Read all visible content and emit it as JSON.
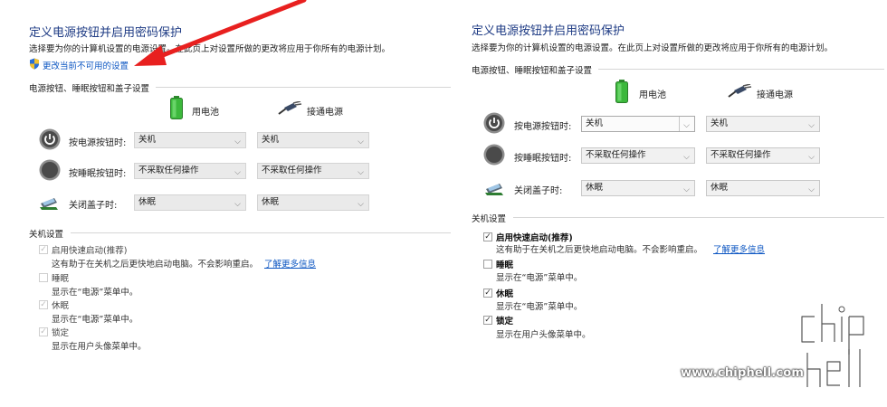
{
  "left": {
    "title": "定义电源按钮并启用密码保护",
    "description": "选择要为你的计算机设置的电源设置。在此页上对设置所做的更改将应用于你所有的电源计划。",
    "change_link": "更改当前不可用的设置",
    "buttons_section": "电源按钮、睡眠按钮和盖子设置",
    "col_battery": "用电池",
    "col_plugged": "接通电源",
    "rows": [
      {
        "label": "按电源按钮时:",
        "battery": "关机",
        "plugged": "关机"
      },
      {
        "label": "按睡眠按钮时:",
        "battery": "不采取任何操作",
        "plugged": "不采取任何操作"
      },
      {
        "label": "关闭盖子时:",
        "battery": "休眠",
        "plugged": "休眠"
      }
    ],
    "shutdown_section": "关机设置",
    "shutdown_items": [
      {
        "label": "启用快速启动(推荐)",
        "checked": true,
        "desc": "这有助于在关机之后更快地启动电脑。不会影响重启。",
        "link": "了解更多信息"
      },
      {
        "label": "睡眠",
        "checked": false,
        "desc": "显示在“电源”菜单中。"
      },
      {
        "label": "休眠",
        "checked": true,
        "desc": "显示在“电源”菜单中。"
      },
      {
        "label": "锁定",
        "checked": true,
        "desc": "显示在用户头像菜单中。"
      }
    ]
  },
  "right": {
    "title": "定义电源按钮并启用密码保护",
    "description": "选择要为你的计算机设置的电源设置。在此页上对设置所做的更改将应用于你所有的电源计划。",
    "buttons_section": "电源按钮、睡眠按钮和盖子设置",
    "col_battery": "用电池",
    "col_plugged": "接通电源",
    "rows": [
      {
        "label": "按电源按钮时:",
        "battery": "关机",
        "plugged": "关机"
      },
      {
        "label": "按睡眠按钮时:",
        "battery": "不采取任何操作",
        "plugged": "不采取任何操作"
      },
      {
        "label": "关闭盖子时:",
        "battery": "休眠",
        "plugged": "休眠"
      }
    ],
    "shutdown_section": "关机设置",
    "shutdown_items": [
      {
        "label": "启用快速启动(推荐)",
        "checked": true,
        "desc": "这有助于在关机之后更快地启动电脑。不会影响重启。",
        "link": "了解更多信息"
      },
      {
        "label": "睡眠",
        "checked": false,
        "desc": "显示在“电源”菜单中。"
      },
      {
        "label": "休眠",
        "checked": true,
        "desc": "显示在“电源”菜单中。"
      },
      {
        "label": "锁定",
        "checked": true,
        "desc": "显示在用户头像菜单中。"
      }
    ]
  },
  "watermark": {
    "url": "www.chiphell.com",
    "logo": "chiphell-logo"
  },
  "colors": {
    "title": "#1e3b84",
    "link": "#0b55c2",
    "annotation_arrow": "#e8201f"
  }
}
